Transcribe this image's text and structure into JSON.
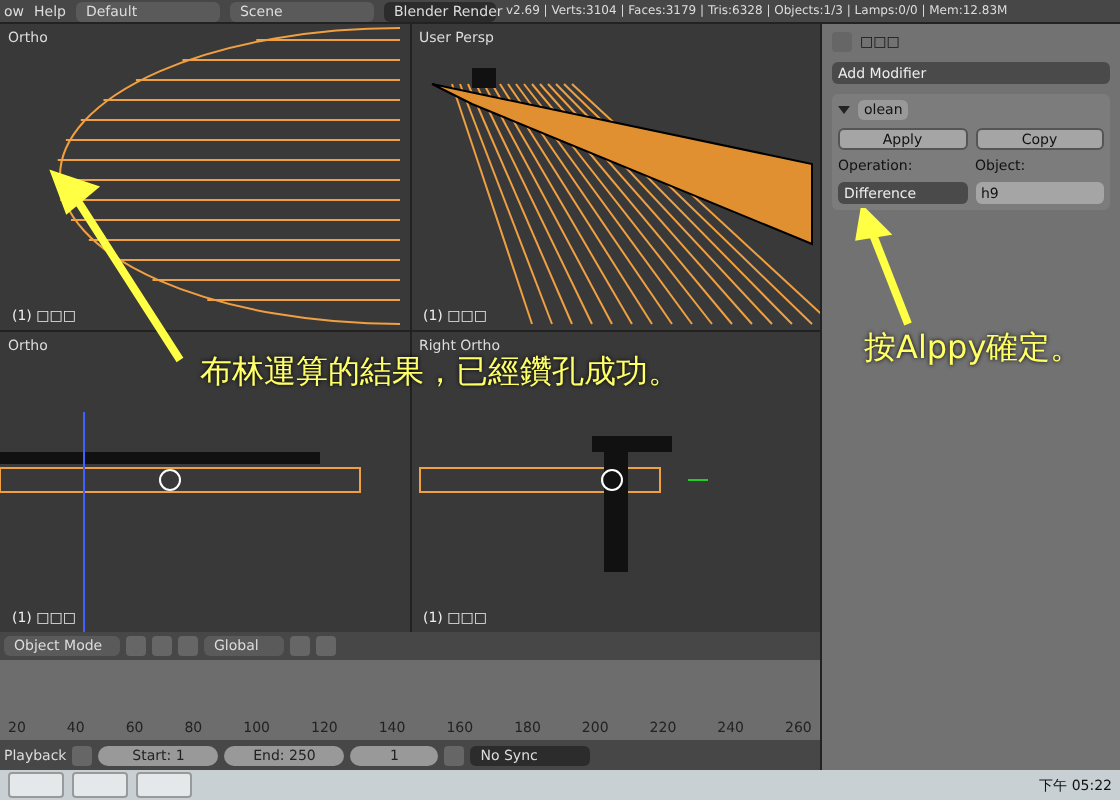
{
  "top_bar": {
    "menus": [
      "ow",
      "Help"
    ],
    "layout": "Default",
    "scene": "Scene",
    "engine": "Blender Render",
    "stats": "v2.69 | Verts:3104 | Faces:3179 | Tris:6328 | Objects:1/3 | Lamps:0/0 | Mem:12.83M"
  },
  "viewports": [
    {
      "kind": "front",
      "title": "Ortho",
      "object_label": "(1) □□□"
    },
    {
      "kind": "persp",
      "title": "User Persp",
      "object_label": "(1) □□□"
    },
    {
      "kind": "bottom",
      "title": "Ortho",
      "object_label": "(1) □□□"
    },
    {
      "kind": "side",
      "title": "Right Ortho",
      "object_label": "(1) □□□"
    }
  ],
  "properties": {
    "object_name": "□□□",
    "add_modifier": "Add Modifier",
    "modifier": {
      "name": "olean",
      "expanded": true,
      "apply": "Apply",
      "copy": "Copy",
      "operation_label": "Operation:",
      "operation": "Difference",
      "object_label": "Object:",
      "object": "h9"
    }
  },
  "toolbar": {
    "mode": "Object Mode",
    "orientation": "Global"
  },
  "timeline": {
    "ticks": [
      "20",
      "40",
      "60",
      "80",
      "100",
      "120",
      "140",
      "160",
      "180",
      "200",
      "220",
      "240",
      "260"
    ]
  },
  "playback": {
    "label": "Playback",
    "start": "Start: 1",
    "end": "End: 250",
    "frame": "1",
    "sync": "No Sync"
  },
  "taskbar": {
    "clock": "下午 05:22"
  },
  "annotations": [
    {
      "kind": "left",
      "text": "布林運算的結果，已經鑽孔成功。"
    },
    {
      "kind": "right",
      "text": "按Alppy確定。"
    }
  ]
}
